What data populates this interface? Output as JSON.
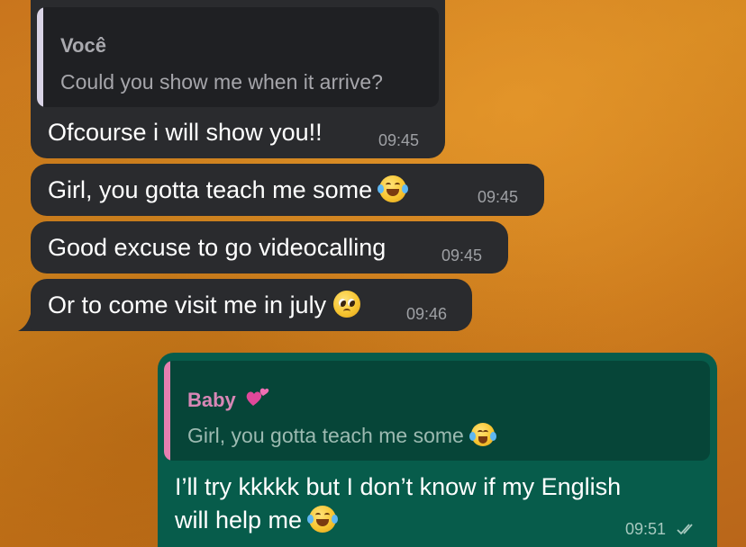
{
  "messages": {
    "m1": {
      "quote_author": "Você",
      "quote_text": "Could you show me when it arrive?",
      "text": "Ofcourse i will show you!!",
      "time": "09:45"
    },
    "m2": {
      "text": "Girl, you gotta teach me some",
      "emoji": "face-with-tears-of-joy",
      "time": "09:45"
    },
    "m3": {
      "text": "Good excuse to go videocalling",
      "time": "09:45"
    },
    "m4": {
      "text": "Or to come visit me in july",
      "emoji": "pleading-face",
      "time": "09:46"
    },
    "m5": {
      "quote_author": "Baby",
      "quote_author_emoji": "two-hearts",
      "quote_text": "Girl, you gotta teach me some",
      "quote_emoji": "face-with-tears-of-joy",
      "text_line1": "I’ll try kkkkk but I don’t know if my English",
      "text_line2": "will help me",
      "emoji": "face-with-tears-of-joy",
      "time": "09:51",
      "status": "read-double-check"
    }
  },
  "colors": {
    "incoming_bubble": "#2a2b2e",
    "outgoing_bubble": "#075c4b",
    "incoming_quote_bar": "#d9d4e6",
    "outgoing_quote_bar": "#e77fb1",
    "outgoing_quote_author": "#d887b6",
    "background": "#c9751d"
  }
}
